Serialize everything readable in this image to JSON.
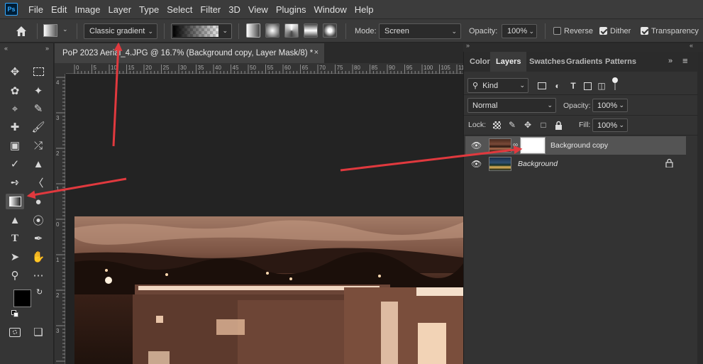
{
  "menu": {
    "logo": "Ps",
    "items": [
      "File",
      "Edit",
      "Image",
      "Layer",
      "Type",
      "Select",
      "Filter",
      "3D",
      "View",
      "Plugins",
      "Window",
      "Help"
    ]
  },
  "options": {
    "gradient_type": "Classic gradient",
    "mode_label": "Mode:",
    "mode_value": "Screen",
    "opacity_label": "Opacity:",
    "opacity_value": "100%",
    "reverse_label": "Reverse",
    "reverse_checked": false,
    "dither_label": "Dither",
    "dither_checked": true,
    "transparency_label": "Transparency",
    "transparency_checked": true
  },
  "document": {
    "tab_title": "PoP 2023 Aerial_4.JPG @ 16.7% (Background copy, Layer Mask/8) *",
    "close_glyph": "×",
    "ruler_h": [
      "0",
      "5",
      "10",
      "15",
      "20",
      "25",
      "30",
      "35",
      "40",
      "45",
      "50",
      "55",
      "60",
      "65",
      "70",
      "75",
      "80",
      "85",
      "90",
      "95",
      "100",
      "105",
      "110"
    ],
    "ruler_v": [
      "4",
      "3",
      "2",
      "1",
      "0",
      "1",
      "2",
      "3"
    ]
  },
  "toolbar": {
    "active_tool": "gradient-tool",
    "foreground_color": "#000000",
    "background_color": "#ffffff"
  },
  "panel": {
    "tabs": [
      "Color",
      "Layers",
      "Swatches",
      "Gradients",
      "Patterns"
    ],
    "active_tab": "Layers",
    "filter_kind": "Kind",
    "blend_mode": "Normal",
    "opacity_label": "Opacity:",
    "opacity_value": "100%",
    "lock_label": "Lock:",
    "fill_label": "Fill:",
    "fill_value": "100%",
    "layers": [
      {
        "name": "Background copy",
        "selected": true,
        "has_mask": true
      },
      {
        "name": "Background",
        "selected": false,
        "locked": true
      }
    ]
  },
  "colors": {
    "accent_arrow": "#e0393e",
    "photo_tone": "#8a5a44"
  }
}
